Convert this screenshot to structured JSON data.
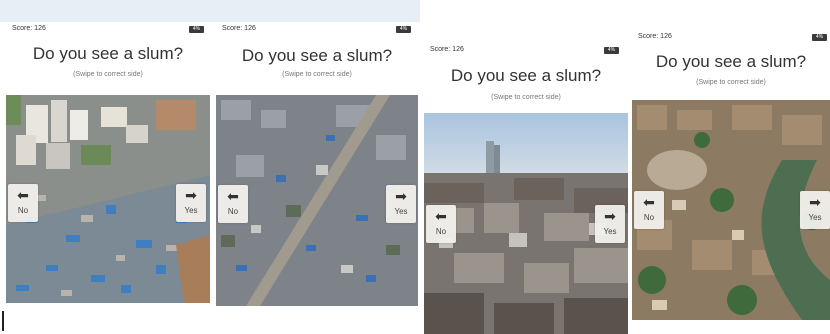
{
  "screens": [
    {
      "score": "Score: 126",
      "battery": "4%",
      "question": "Do you see a slum?",
      "hint": "(Swipe to correct side)",
      "no_label": "No",
      "yes_label": "Yes"
    },
    {
      "score": "Score: 126",
      "battery": "4%",
      "question": "Do you see a slum?",
      "hint": "(Swipe to correct side)",
      "no_label": "No",
      "yes_label": "Yes"
    },
    {
      "score": "Score: 126",
      "battery": "4%",
      "question": "Do you see a slum?",
      "hint": "(Swipe to correct side)",
      "no_label": "No",
      "yes_label": "Yes"
    },
    {
      "score": "Score: 126",
      "battery": "4%",
      "question": "Do you see a slum?",
      "hint": "(Swipe to correct side)",
      "no_label": "No",
      "yes_label": "Yes"
    }
  ],
  "icons": {
    "left": "arrow-left-icon",
    "right": "arrow-right-icon"
  },
  "colors": {
    "button_bg": "#f2f0ec",
    "text": "#333333",
    "battery": "#3a3a3a"
  }
}
